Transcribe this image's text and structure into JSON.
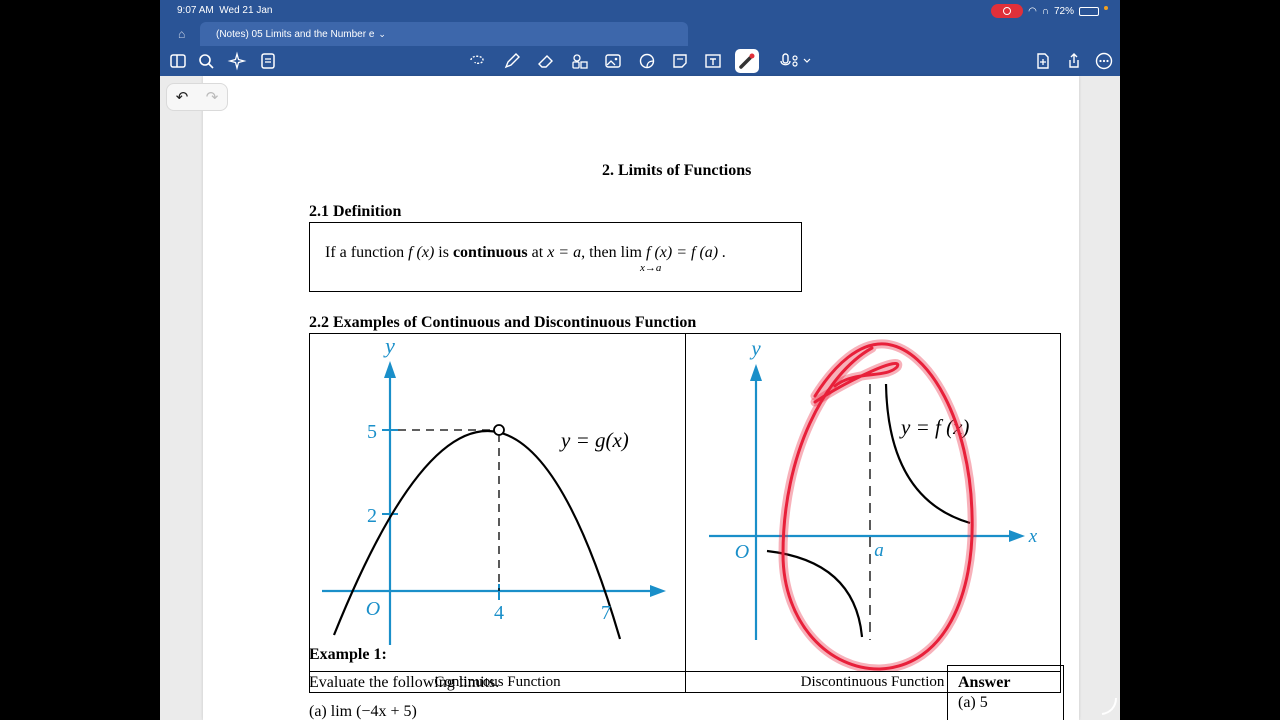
{
  "status": {
    "time": "9:07 AM",
    "date": "Wed 21 Jan",
    "battery": "72%",
    "battery_level": 0.72
  },
  "tab": {
    "title": "(Notes) 05 Limits and the Number e"
  },
  "toolbar": {
    "left_icons": [
      "sidebar-icon",
      "search-icon",
      "magic-icon",
      "document-icon"
    ],
    "center_icons": [
      "lasso-icon",
      "pen-icon",
      "eraser-icon",
      "shapes-icon",
      "image-icon",
      "sticker-icon",
      "sticky-note-icon",
      "text-box-icon",
      "laser-pointer-icon",
      "microphone-icon"
    ],
    "right_icons": [
      "add-page-icon",
      "share-icon",
      "more-icon"
    ],
    "accent_color": "#2a5496",
    "active_tool_color": "#d13b3b"
  },
  "document": {
    "heading": "2. Limits of Functions",
    "section1": "2.1  Definition",
    "definition": {
      "part1": "If a function ",
      "fx": "f (x)",
      "part2": " is ",
      "bold": "continuous",
      "part3": " at ",
      "cond": "x = a",
      "part4": ", then lim ",
      "expr": "f (x) = f (a) .",
      "sub": "x→a"
    },
    "section2": "2.2  Examples of Continuous and Discontinuous Function",
    "graph1": {
      "y_label": "y",
      "origin": "O",
      "y5": "5",
      "y2": "2",
      "x4": "4",
      "x7": "7",
      "func": "y = g(x)",
      "caption": "Continuous Function"
    },
    "graph2": {
      "y_label": "y",
      "x_label": "x",
      "origin": "O",
      "a_label": "a",
      "func": "y = f (x)",
      "caption": "Discontinuous Function"
    },
    "axis_color": "#1a8fc9",
    "annotation_color": "#e8203a",
    "example_title": "Example 1:",
    "example_text": "Evaluate the following limits.",
    "example_a": "(a)   lim (−4x + 5)",
    "answer_title": "Answer",
    "answer_a": "(a) 5"
  }
}
